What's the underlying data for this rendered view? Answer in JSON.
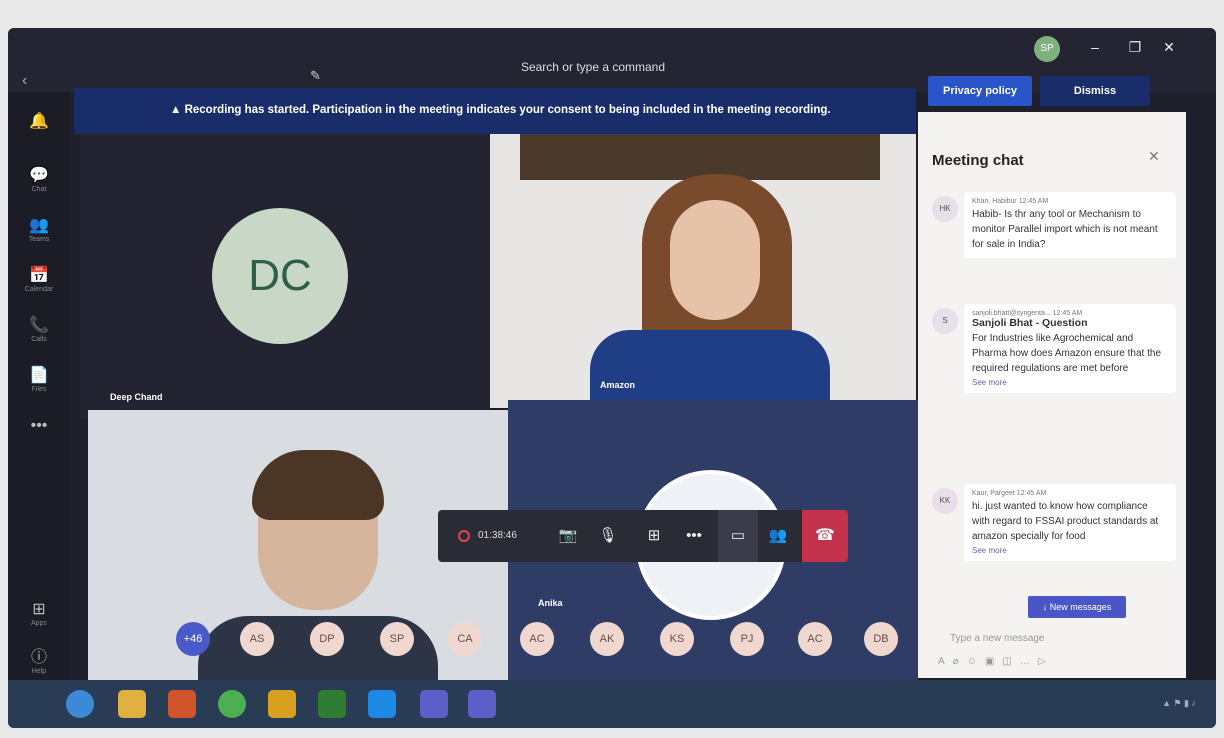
{
  "titlebar": {
    "search_placeholder": "Search or type a command",
    "user_initials": "SP",
    "minimize": "–",
    "maximize": "❐",
    "close": "✕"
  },
  "rail": {
    "items": [
      {
        "icon": "bell-icon",
        "glyph": "🔔"
      },
      {
        "icon": "chat-icon",
        "glyph": "💬",
        "label": "Chat"
      },
      {
        "icon": "teams-icon",
        "glyph": "👥",
        "label": "Teams"
      },
      {
        "icon": "calendar-icon",
        "glyph": "📅",
        "label": "Calendar"
      },
      {
        "icon": "calls-icon",
        "glyph": "📞",
        "label": "Calls"
      },
      {
        "icon": "files-icon",
        "glyph": "📄",
        "label": "Files"
      },
      {
        "icon": "more-icon",
        "glyph": "•••"
      }
    ],
    "apps_label": "Apps",
    "help_label": "Help"
  },
  "banner": {
    "text": "▲  Recording has started. Participation in the meeting indicates your consent to being included in the meeting recording.",
    "privacy_label": "Privacy policy",
    "dismiss_label": "Dismiss"
  },
  "tiles": {
    "dc_initials": "DC",
    "dc_name": "Deep Chand",
    "woman_name": "Amazon",
    "ring_name": "Anika"
  },
  "controls": {
    "timer": "01:38:46"
  },
  "participants": [
    "+46",
    "AS",
    "DP",
    "SP",
    "CA",
    "AC",
    "AK",
    "KS",
    "PJ",
    "AC",
    "DB"
  ],
  "chat": {
    "title": "Meeting chat",
    "messages": [
      {
        "initials": "HK",
        "meta": "Khan, Habibur  12:45 AM",
        "body": "Habib- Is thr any tool or Mechanism to monitor Parallel import which is not meant for sale in India?"
      },
      {
        "initials": "S",
        "meta": "sanjoli.bhatt@syngenta...  12:45 AM",
        "subject": "Sanjoli Bhat - Question",
        "body": "For Industries like Agrochemical and Pharma how does Amazon ensure that the required regulations are met before",
        "see_more": "See more"
      },
      {
        "initials": "KK",
        "meta": "Kaur, Pargeet  12:45 AM",
        "body": "hi. just wanted to know how compliance with regard to FSSAI product standards at amazon specially for food",
        "see_more": "See more"
      }
    ],
    "new_messages": "↓  New messages",
    "compose_placeholder": "Type a new message"
  }
}
